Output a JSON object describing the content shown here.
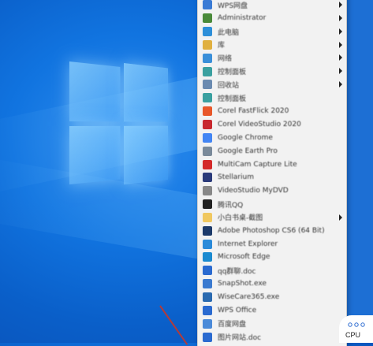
{
  "menu": {
    "items": [
      {
        "label": "WPS网盘",
        "icon": "cloud-icon",
        "color": "#3a7bd5",
        "submenu": true
      },
      {
        "label": "Administrator",
        "icon": "user-icon",
        "color": "#4a8a3a",
        "submenu": true
      },
      {
        "label": "此电脑",
        "icon": "computer-icon",
        "color": "#2d8fd9",
        "submenu": true
      },
      {
        "label": "库",
        "icon": "library-icon",
        "color": "#e0b040",
        "submenu": true
      },
      {
        "label": "网络",
        "icon": "network-icon",
        "color": "#3a8fd9",
        "submenu": true
      },
      {
        "label": "控制面板",
        "icon": "control-panel-icon",
        "color": "#3aa0a0",
        "submenu": true
      },
      {
        "label": "回收站",
        "icon": "recycle-bin-icon",
        "color": "#6a8ab0",
        "submenu": true
      },
      {
        "label": "控制面板",
        "icon": "control-panel-icon",
        "color": "#3aa0a0",
        "submenu": false
      },
      {
        "label": "Corel FastFlick 2020",
        "icon": "corel-fastflick-icon",
        "color": "#e8572a",
        "submenu": false
      },
      {
        "label": "Corel VideoStudio 2020",
        "icon": "corel-videostudio-icon",
        "color": "#c8282e",
        "submenu": false
      },
      {
        "label": "Google Chrome",
        "icon": "chrome-icon",
        "color": "#4285f4",
        "submenu": false
      },
      {
        "label": "Google Earth Pro",
        "icon": "google-earth-icon",
        "color": "#7a8a9a",
        "submenu": false
      },
      {
        "label": "MultiCam Capture Lite",
        "icon": "multicam-icon",
        "color": "#d42a2a",
        "submenu": false
      },
      {
        "label": "Stellarium",
        "icon": "stellarium-icon",
        "color": "#2a3a7a",
        "submenu": false
      },
      {
        "label": "VideoStudio MyDVD",
        "icon": "mydvd-icon",
        "color": "#888888",
        "submenu": false
      },
      {
        "label": "腾讯QQ",
        "icon": "qq-icon",
        "color": "#222222",
        "submenu": false
      },
      {
        "label": "小白书桌-截图",
        "icon": "folder-icon",
        "color": "#f0c860",
        "submenu": true
      },
      {
        "label": "Adobe Photoshop CS6 (64 Bit)",
        "icon": "photoshop-icon",
        "color": "#1c3a6a",
        "submenu": false
      },
      {
        "label": "Internet Explorer",
        "icon": "ie-icon",
        "color": "#2a8ad9",
        "submenu": false
      },
      {
        "label": "Microsoft Edge",
        "icon": "edge-icon",
        "color": "#1a8ad0",
        "submenu": false
      },
      {
        "label": "qq群聊.doc",
        "icon": "doc-icon",
        "color": "#2a6ad0",
        "submenu": false
      },
      {
        "label": "SnapShot.exe",
        "icon": "snapshot-icon",
        "color": "#3a7ad0",
        "submenu": false
      },
      {
        "label": "WiseCare365.exe",
        "icon": "wisecare-icon",
        "color": "#2a6ab0",
        "submenu": false
      },
      {
        "label": "WPS Office",
        "icon": "wps-icon",
        "color": "#2a6ad0",
        "submenu": false
      },
      {
        "label": "百度网盘",
        "icon": "baidu-netdisk-icon",
        "color": "#4a8ad9",
        "submenu": false
      },
      {
        "label": "图片网站.doc",
        "icon": "doc-icon",
        "color": "#2a6ad0",
        "submenu": false
      }
    ]
  },
  "tray": {
    "cpu_label": "CPU"
  }
}
